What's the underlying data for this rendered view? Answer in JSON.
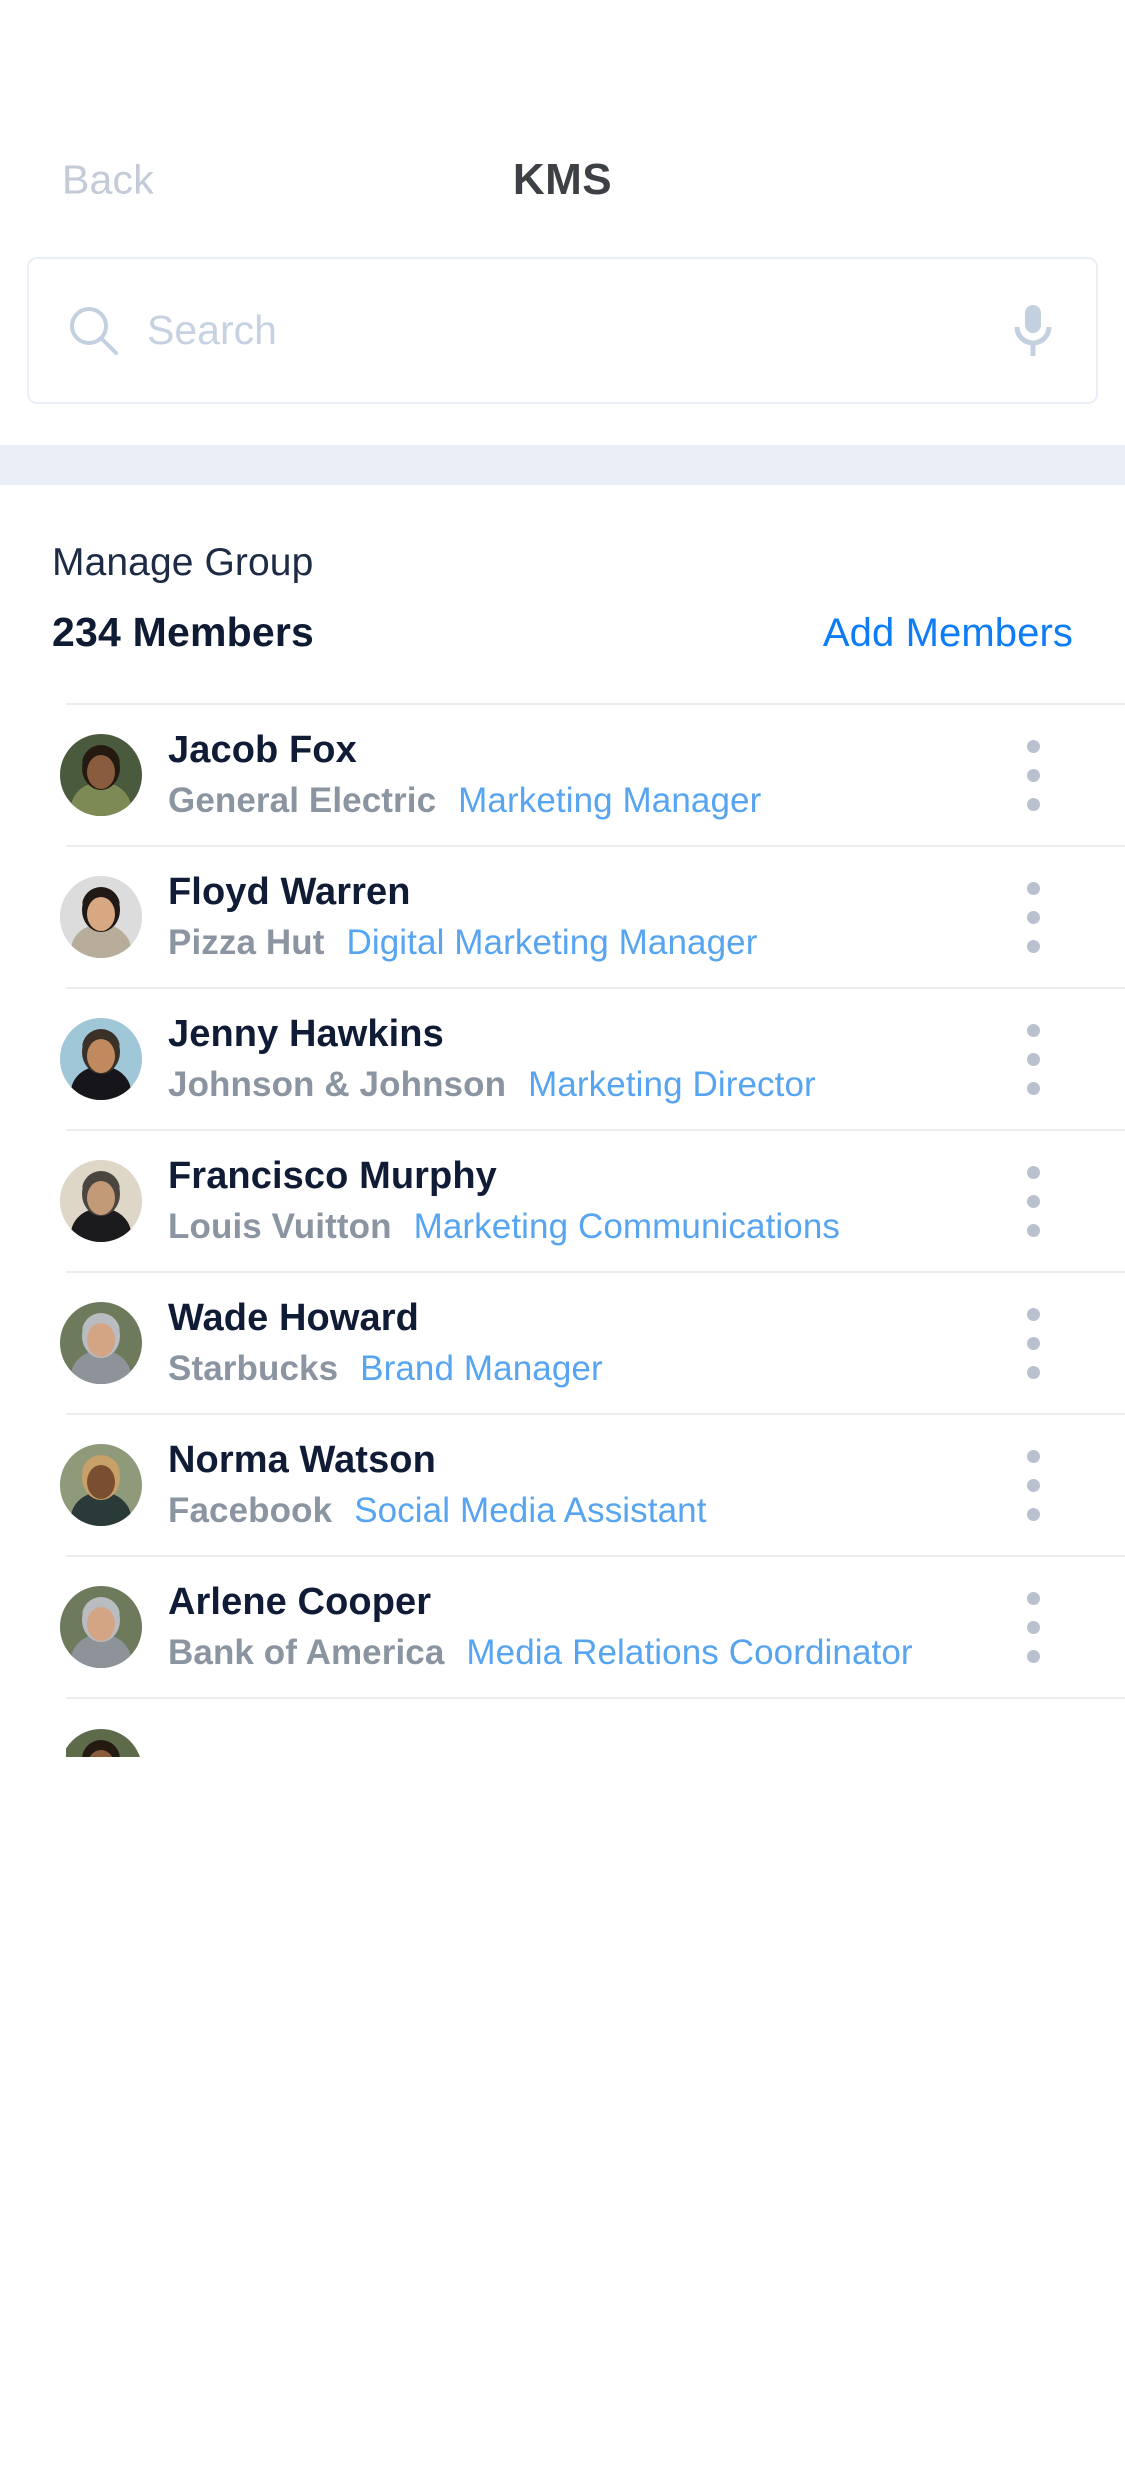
{
  "nav": {
    "back_label": "Back",
    "title": "KMS"
  },
  "search": {
    "placeholder": "Search",
    "value": "",
    "search_icon": "search-icon",
    "mic_icon": "microphone-icon"
  },
  "section": {
    "title": "Manage Group",
    "member_count": "234 Members",
    "add_members_label": "Add Members"
  },
  "colors": {
    "accent_blue": "#0d7cf5",
    "role_blue": "#57a4f0",
    "name_navy": "#101c36",
    "company_gray": "#8b94a1",
    "band_gray": "#eaeef6",
    "kebab_gray": "#b9c1ce",
    "back_gray": "#c3cad8"
  },
  "members": [
    {
      "name": "Jacob Fox",
      "company": "General Electric",
      "role": "Marketing Manager",
      "avatar": {
        "bg": "#4a5a3c",
        "skin": "#8a5c3e",
        "hair": "#241a12",
        "shirt": "#7e8a55"
      }
    },
    {
      "name": "Floyd Warren",
      "company": "Pizza Hut",
      "role": "Digital Marketing Manager",
      "avatar": {
        "bg": "#dcdcdc",
        "skin": "#d8a882",
        "hair": "#201914",
        "shirt": "#b8ad9a"
      }
    },
    {
      "name": "Jenny Hawkins",
      "company": "Johnson & Johnson",
      "role": "Marketing Director",
      "avatar": {
        "bg": "#9fc7d8",
        "skin": "#c08a5e",
        "hair": "#3a3129",
        "shirt": "#16161a"
      }
    },
    {
      "name": "Francisco Murphy",
      "company": "Louis Vuitton",
      "role": "Marketing Communications",
      "avatar": {
        "bg": "#ded6c6",
        "skin": "#c39a78",
        "hair": "#4b453f",
        "shirt": "#1b1b1d"
      }
    },
    {
      "name": "Wade Howard",
      "company": "Starbucks",
      "role": "Brand Manager",
      "avatar": {
        "bg": "#6d7a5c",
        "skin": "#d3a585",
        "hair": "#b9bcc0",
        "shirt": "#8e9299"
      }
    },
    {
      "name": "Norma Watson",
      "company": "Facebook",
      "role": "Social Media Assistant",
      "avatar": {
        "bg": "#8e9a7a",
        "skin": "#7a4e30",
        "hair": "#c8a169",
        "shirt": "#2a3a38"
      }
    },
    {
      "name": "Arlene Cooper",
      "company": "Bank of America",
      "role": "Media Relations Coordinator",
      "avatar": {
        "bg": "#6d7a5c",
        "skin": "#d3a585",
        "hair": "#b9bcc0",
        "shirt": "#8e9299"
      }
    },
    {
      "name": "",
      "company": "",
      "role": "",
      "partial": true,
      "avatar": {
        "bg": "#5d6b4a",
        "skin": "#8a5c3e",
        "hair": "#241a12",
        "shirt": "#6f7a4e"
      }
    }
  ]
}
